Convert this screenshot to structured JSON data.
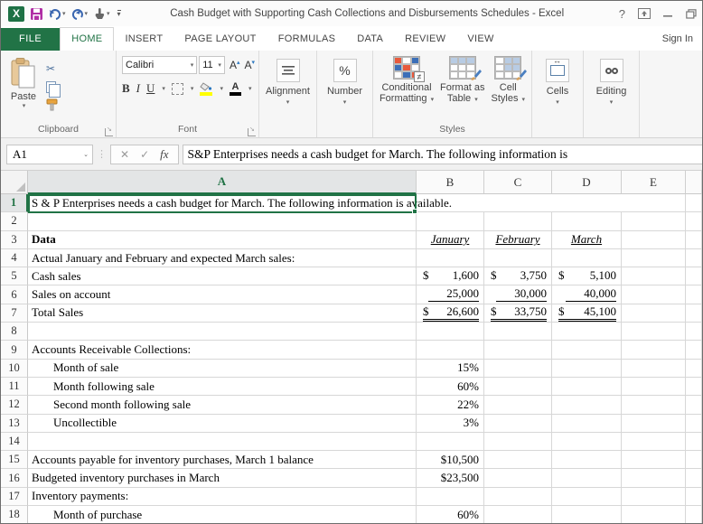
{
  "window": {
    "title": "Cash Budget with Supporting Cash Collections and Disbursements Schedules - Excel",
    "help": "?",
    "excel_logo": "X"
  },
  "tabs": {
    "file": "FILE",
    "items": [
      "HOME",
      "INSERT",
      "PAGE LAYOUT",
      "FORMULAS",
      "DATA",
      "REVIEW",
      "VIEW"
    ],
    "active": "HOME",
    "sign_in": "Sign In"
  },
  "ribbon": {
    "paste_label": "Paste",
    "clipboard_group": "Clipboard",
    "font_name": "Calibri",
    "font_size": "11",
    "font_group": "Font",
    "bold": "B",
    "italic": "I",
    "underline": "U",
    "grow_font": "A",
    "shrink_font": "A",
    "font_color_a": "A",
    "alignment_label": "Alignment",
    "number_label": "Number",
    "percent_icon": "%",
    "cond_fmt_line1": "Conditional",
    "cond_fmt_line2": "Formatting",
    "fmt_table_line1": "Format as",
    "fmt_table_line2": "Table",
    "cell_styles_line1": "Cell",
    "cell_styles_line2": "Styles",
    "styles_group": "Styles",
    "cells_label": "Cells",
    "editing_label": "Editing"
  },
  "formula_bar": {
    "cell_ref": "A1",
    "cancel": "✕",
    "enter": "✓",
    "fx": "fx",
    "formula": "S&P Enterprises needs a cash budget for March. The following information is"
  },
  "sheet": {
    "columns": [
      "A",
      "B",
      "C",
      "D",
      "E"
    ],
    "currency": "$",
    "selection": "A1",
    "rows": [
      {
        "n": "1",
        "a": "S & P Enterprises needs a cash budget for March. The following information is available.",
        "a_fmt": "span-a"
      },
      {
        "n": "2"
      },
      {
        "n": "3",
        "a": "Data",
        "a_fmt": "bold",
        "B": {
          "t": "January",
          "f": "month"
        },
        "C": {
          "t": "February",
          "f": "month"
        },
        "D": {
          "t": "March",
          "f": "month"
        }
      },
      {
        "n": "4",
        "a": "Actual January and February and expected March sales:"
      },
      {
        "n": "5",
        "a": "Cash sales",
        "B": {
          "t": "1,600",
          "f": "acct"
        },
        "C": {
          "t": "3,750",
          "f": "acct"
        },
        "D": {
          "t": "5,100",
          "f": "acct"
        }
      },
      {
        "n": "6",
        "a": "Sales on account",
        "B": {
          "t": "25,000",
          "f": "ul"
        },
        "C": {
          "t": "30,000",
          "f": "ul"
        },
        "D": {
          "t": "40,000",
          "f": "ul"
        }
      },
      {
        "n": "7",
        "a": "Total Sales",
        "B": {
          "t": "26,600",
          "f": "acct2"
        },
        "C": {
          "t": "33,750",
          "f": "acct2"
        },
        "D": {
          "t": "45,100",
          "f": "acct2"
        }
      },
      {
        "n": "8"
      },
      {
        "n": "9",
        "a": "Accounts Receivable Collections:"
      },
      {
        "n": "10",
        "a": "Month of sale",
        "a_fmt": "indent",
        "B": {
          "t": "15%",
          "f": "right"
        }
      },
      {
        "n": "11",
        "a": "Month following sale",
        "a_fmt": "indent",
        "B": {
          "t": "60%",
          "f": "right"
        }
      },
      {
        "n": "12",
        "a": "Second month following sale",
        "a_fmt": "indent",
        "B": {
          "t": "22%",
          "f": "right"
        }
      },
      {
        "n": "13",
        "a": "Uncollectible",
        "a_fmt": "indent",
        "B": {
          "t": "3%",
          "f": "right"
        }
      },
      {
        "n": "14"
      },
      {
        "n": "15",
        "a": "Accounts payable for inventory purchases, March 1 balance",
        "B": {
          "t": "$10,500",
          "f": "right"
        }
      },
      {
        "n": "16",
        "a": "Budgeted inventory purchases in March",
        "B": {
          "t": "$23,500",
          "f": "right"
        }
      },
      {
        "n": "17",
        "a": "Inventory payments:"
      },
      {
        "n": "18",
        "a": "Month of purchase",
        "a_fmt": "indent",
        "B": {
          "t": "60%",
          "f": "right"
        }
      }
    ]
  },
  "colors": {
    "excel_green": "#217346",
    "save_icon": "#b02fa5",
    "undo_redo_blue": "#3a66b0",
    "fill_yellow": "#ffff00",
    "font_color_bar": "#000000"
  }
}
